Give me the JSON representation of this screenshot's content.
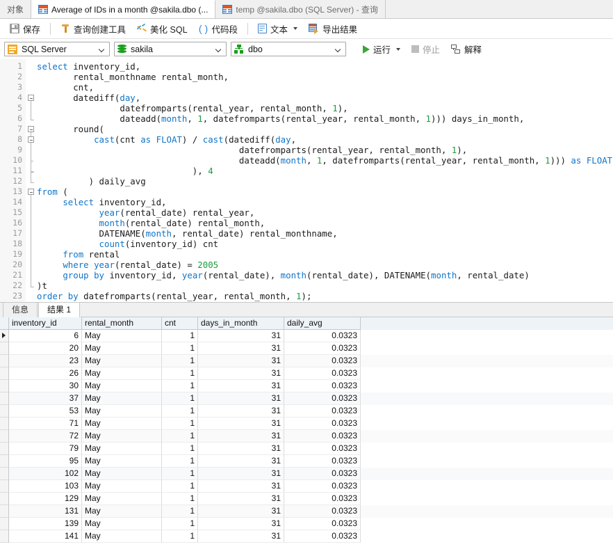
{
  "tabbar": {
    "object_tab": "对象",
    "tabs": [
      {
        "label": "Average of IDs in a month @sakila.dbo (...",
        "icon": "table-grid-icon",
        "active": true
      },
      {
        "label": "temp @sakila.dbo (SQL Server) - 查询",
        "icon": "table-grid-icon",
        "active": false
      }
    ]
  },
  "toolbar": {
    "save": "保存",
    "query_builder": "查询创建工具",
    "beautify_sql": "美化 SQL",
    "code_snippet": "代码段",
    "text": "文本",
    "export_results": "导出结果",
    "paren_glyph": "( )"
  },
  "selectors": {
    "connection": "SQL Server",
    "database": "sakila",
    "schema": "dbo",
    "run": "运行",
    "stop": "停止",
    "explain": "解释"
  },
  "editor": {
    "line_numbers": [
      1,
      2,
      3,
      4,
      5,
      6,
      7,
      8,
      9,
      10,
      11,
      12,
      13,
      14,
      15,
      16,
      17,
      18,
      19,
      20,
      21,
      22,
      23
    ],
    "lines": [
      {
        "n": 1,
        "indent": 0,
        "text": "select inventory_id,"
      },
      {
        "n": 2,
        "indent": 0,
        "text": "       rental_monthname rental_month,"
      },
      {
        "n": 3,
        "indent": 0,
        "text": "       cnt,"
      },
      {
        "n": 4,
        "indent": 0,
        "text": "       datediff(day,"
      },
      {
        "n": 5,
        "indent": 0,
        "text": "                datefromparts(rental_year, rental_month, 1),"
      },
      {
        "n": 6,
        "indent": 0,
        "text": "                dateadd(month, 1, datefromparts(rental_year, rental_month, 1))) days_in_month,"
      },
      {
        "n": 7,
        "indent": 0,
        "text": "       round("
      },
      {
        "n": 8,
        "indent": 0,
        "text": "           cast(cnt as FLOAT) / cast(datediff(day,"
      },
      {
        "n": 9,
        "indent": 0,
        "text": "                                       datefromparts(rental_year, rental_month, 1),"
      },
      {
        "n": 10,
        "indent": 0,
        "text": "                                       dateadd(month, 1, datefromparts(rental_year, rental_month, 1))) as FLOAT"
      },
      {
        "n": 11,
        "indent": 0,
        "text": "                              ), 4"
      },
      {
        "n": 12,
        "indent": 0,
        "text": "          ) daily_avg"
      },
      {
        "n": 13,
        "indent": 0,
        "text": "from ("
      },
      {
        "n": 14,
        "indent": 0,
        "text": "     select inventory_id,"
      },
      {
        "n": 15,
        "indent": 0,
        "text": "            year(rental_date) rental_year,"
      },
      {
        "n": 16,
        "indent": 0,
        "text": "            month(rental_date) rental_month,"
      },
      {
        "n": 17,
        "indent": 0,
        "text": "            DATENAME(month, rental_date) rental_monthname,"
      },
      {
        "n": 18,
        "indent": 0,
        "text": "            count(inventory_id) cnt"
      },
      {
        "n": 19,
        "indent": 0,
        "text": "     from rental"
      },
      {
        "n": 20,
        "indent": 0,
        "text": "     where year(rental_date) = 2005"
      },
      {
        "n": 21,
        "indent": 0,
        "text": "     group by inventory_id, year(rental_date), month(rental_date), DATENAME(month, rental_date)"
      },
      {
        "n": 22,
        "indent": 0,
        "text": ")t"
      },
      {
        "n": 23,
        "indent": 0,
        "text": "order by datefromparts(rental_year, rental_month, 1);"
      }
    ]
  },
  "results": {
    "tabs": [
      {
        "label": "信息",
        "active": false
      },
      {
        "label": "结果 1",
        "active": true
      }
    ],
    "columns": [
      "inventory_id",
      "rental_month",
      "cnt",
      "days_in_month",
      "daily_avg"
    ],
    "rows": [
      {
        "inventory_id": "6",
        "rental_month": "May",
        "cnt": "1",
        "days_in_month": "31",
        "daily_avg": "0.0323"
      },
      {
        "inventory_id": "20",
        "rental_month": "May",
        "cnt": "1",
        "days_in_month": "31",
        "daily_avg": "0.0323"
      },
      {
        "inventory_id": "23",
        "rental_month": "May",
        "cnt": "1",
        "days_in_month": "31",
        "daily_avg": "0.0323"
      },
      {
        "inventory_id": "26",
        "rental_month": "May",
        "cnt": "1",
        "days_in_month": "31",
        "daily_avg": "0.0323"
      },
      {
        "inventory_id": "30",
        "rental_month": "May",
        "cnt": "1",
        "days_in_month": "31",
        "daily_avg": "0.0323"
      },
      {
        "inventory_id": "37",
        "rental_month": "May",
        "cnt": "1",
        "days_in_month": "31",
        "daily_avg": "0.0323"
      },
      {
        "inventory_id": "53",
        "rental_month": "May",
        "cnt": "1",
        "days_in_month": "31",
        "daily_avg": "0.0323"
      },
      {
        "inventory_id": "71",
        "rental_month": "May",
        "cnt": "1",
        "days_in_month": "31",
        "daily_avg": "0.0323"
      },
      {
        "inventory_id": "72",
        "rental_month": "May",
        "cnt": "1",
        "days_in_month": "31",
        "daily_avg": "0.0323"
      },
      {
        "inventory_id": "79",
        "rental_month": "May",
        "cnt": "1",
        "days_in_month": "31",
        "daily_avg": "0.0323"
      },
      {
        "inventory_id": "95",
        "rental_month": "May",
        "cnt": "1",
        "days_in_month": "31",
        "daily_avg": "0.0323"
      },
      {
        "inventory_id": "102",
        "rental_month": "May",
        "cnt": "1",
        "days_in_month": "31",
        "daily_avg": "0.0323"
      },
      {
        "inventory_id": "103",
        "rental_month": "May",
        "cnt": "1",
        "days_in_month": "31",
        "daily_avg": "0.0323"
      },
      {
        "inventory_id": "129",
        "rental_month": "May",
        "cnt": "1",
        "days_in_month": "31",
        "daily_avg": "0.0323"
      },
      {
        "inventory_id": "131",
        "rental_month": "May",
        "cnt": "1",
        "days_in_month": "31",
        "daily_avg": "0.0323"
      },
      {
        "inventory_id": "139",
        "rental_month": "May",
        "cnt": "1",
        "days_in_month": "31",
        "daily_avg": "0.0323"
      },
      {
        "inventory_id": "141",
        "rental_month": "May",
        "cnt": "1",
        "days_in_month": "31",
        "daily_avg": "0.0323"
      }
    ]
  },
  "colors": {
    "keyword": "#0f74c8",
    "number": "#1a9a3c",
    "run_green": "#3aa53a",
    "header_blue": "#eef3f8",
    "tabbar_grey": "#f0f0f0"
  }
}
